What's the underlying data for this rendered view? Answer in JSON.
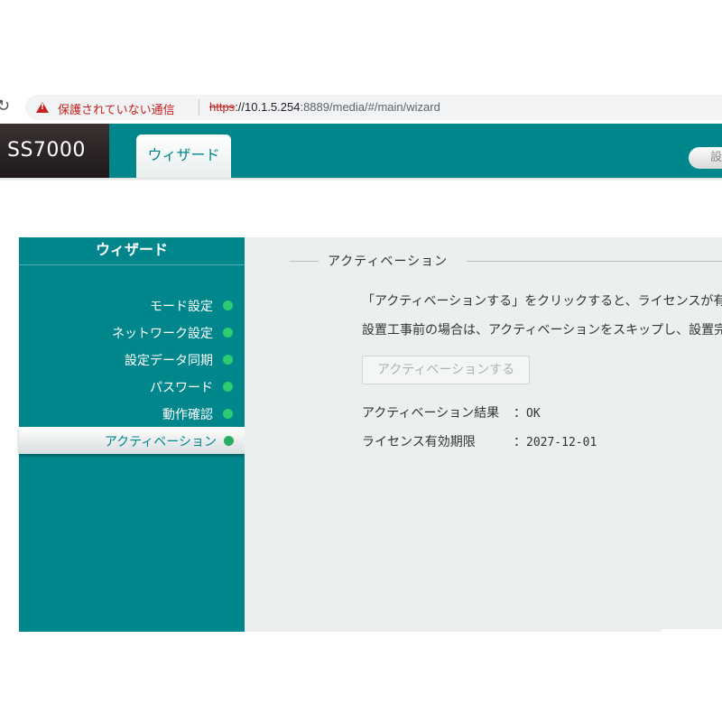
{
  "browser": {
    "security_warning": "保護されていない通信",
    "url_protocol": "https",
    "url_host": "://10.1.5.254",
    "url_path": ":8889/media/#/main/wizard"
  },
  "header": {
    "logo": "SS7000",
    "tab_label": "ウィザード",
    "settings_button_partial": "設"
  },
  "sidebar": {
    "title": "ウィザード",
    "steps": [
      {
        "label": "モード設定",
        "status_color": "#2ecc71"
      },
      {
        "label": "ネットワーク設定",
        "status_color": "#2ecc71"
      },
      {
        "label": "設定データ同期",
        "status_color": "#2ecc71"
      },
      {
        "label": "パスワード",
        "status_color": "#2ecc71"
      },
      {
        "label": "動作確認",
        "status_color": "#2ecc71"
      },
      {
        "label": "アクティベーション",
        "status_color": "#27ae60",
        "active": true
      }
    ]
  },
  "main": {
    "section_title": "アクティベーション",
    "description_line1": "「アクティベーションする」をクリックすると、ライセンスが有",
    "description_line2": "設置工事前の場合は、アクティベーションをスキップし、設置完",
    "activate_button": "アクティベーションする",
    "result_label": "アクティベーション結果",
    "result_value": "OK",
    "license_label": "ライセンス有効期限",
    "license_value": "2027-12-01",
    "separator": "："
  },
  "colors": {
    "brand_teal": "#00868b",
    "panel_background": "#ebf0ef",
    "warning_red": "#c5221f"
  }
}
